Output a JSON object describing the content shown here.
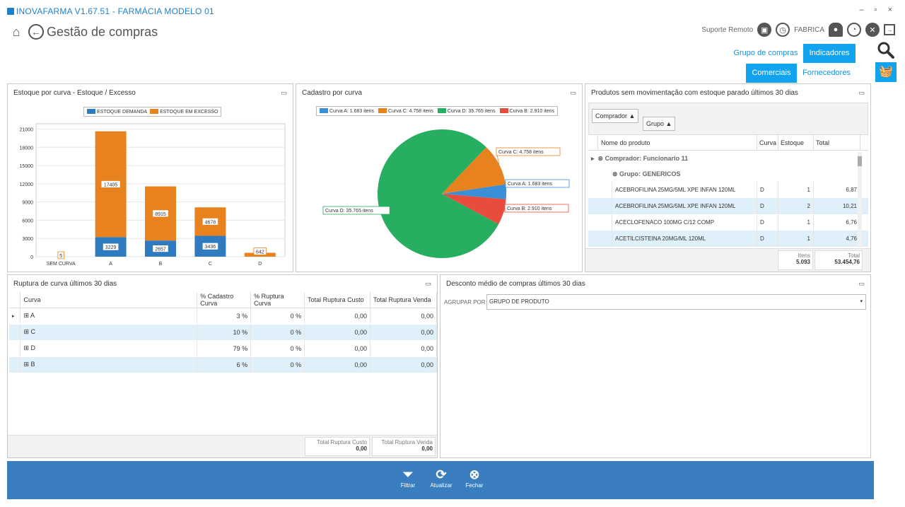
{
  "app": {
    "title": "INOVAFARMA  V1.67.51 - FARMÁCIA MODELO 01",
    "page_title": "Gestão de compras",
    "window_controls": "– ▫ ×"
  },
  "header": {
    "suporte_label": "Suporte Remoto",
    "user_label": "FABRICA"
  },
  "nav": {
    "grupo_compras": "Grupo de compras",
    "indicadores": "Indicadores",
    "comerciais": "Comerciais",
    "fornecedores": "Fornecedores"
  },
  "colors": {
    "accent": "#12a3ee",
    "demanda": "#2e7bbf",
    "excesso": "#e8821e",
    "curvaA": "#3b8fd6",
    "curvaB": "#e84c3d",
    "curvaC": "#e8821e",
    "curvaD": "#27ae60",
    "bottombar": "#3a7ebf"
  },
  "estoque_panel": {
    "title": "Estoque por curva - Estoque / Excesso",
    "legend": [
      "ESTOQUE DEMANDA",
      "ESTOQUE EM EXCESSO"
    ]
  },
  "cadastro_panel": {
    "title": "Cadastro por curva",
    "legend": [
      "Curva A: 1.683 itens",
      "Curva C: 4.758 itens",
      "Curva D: 35.765 itens",
      "Curva B: 2.910 itens"
    ],
    "labels": {
      "C": "Curva C: 4.758 itens",
      "A": "Curva A: 1.683 itens",
      "B": "Curva B: 2.910 itens",
      "D": "Curva D: 35.765 itens"
    }
  },
  "chart_data": [
    {
      "type": "bar",
      "stacked": true,
      "title": "Estoque por curva - Estoque / Excesso",
      "categories": [
        "SEM CURVA",
        "A",
        "B",
        "C",
        "D"
      ],
      "series": [
        {
          "name": "ESTOQUE DEMANDA",
          "values": [
            0,
            3229,
            2657,
            3436,
            0
          ]
        },
        {
          "name": "ESTOQUE EM EXCESSO",
          "values": [
            5,
            17405,
            8915,
            4678,
            642
          ]
        }
      ],
      "yticks": [
        "0",
        "3000",
        "6000",
        "9000",
        "12000",
        "15000",
        "18000",
        "21000"
      ],
      "ylim": [
        0,
        21000
      ],
      "grid": true,
      "legend": "top"
    },
    {
      "type": "pie",
      "title": "Cadastro por curva",
      "categories": [
        "Curva A",
        "Curva C",
        "Curva D",
        "Curva B"
      ],
      "values": [
        1683,
        4758,
        35765,
        2910
      ]
    }
  ],
  "produtos_panel": {
    "title": "Produtos sem movimentação com estoque parado últimos 30 dias",
    "group_comprador": "Comprador",
    "group_grupo": "Grupo",
    "columns": [
      "Nome do produto",
      "Curva",
      "Estoque",
      "Total"
    ],
    "group_row": "Comprador: Funcionario 11",
    "subgroup_row": "Grupo: GENERICOS",
    "rows": [
      {
        "nome": "ACEBROFILINA 25MG/5ML XPE INFAN 120ML",
        "curva": "D",
        "estoque": "1",
        "total": "6,87"
      },
      {
        "nome": "ACEBROFILINA 25MG/5ML XPE INFAN 120ML",
        "curva": "D",
        "estoque": "2",
        "total": "10,21"
      },
      {
        "nome": "ACECLOFENACO 100MG C/12 COMP",
        "curva": "D",
        "estoque": "1",
        "total": "6,76"
      },
      {
        "nome": "ACETILCISTEINA 20MG/ML 120ML",
        "curva": "D",
        "estoque": "1",
        "total": "4,76"
      }
    ],
    "footer": {
      "itens_label": "Itens",
      "itens_value": "5.093",
      "total_label": "Total",
      "total_value": "53.454,76"
    }
  },
  "ruptura_panel": {
    "title": "Ruptura de curva últimos 30 dias",
    "columns": [
      "Curva",
      "% Cadastro Curva",
      "% Ruptura Curva",
      "Total Ruptura Custo",
      "Total Ruptura Venda"
    ],
    "rows": [
      {
        "curva": "A",
        "cadastro": "3 %",
        "ruptura": "0 %",
        "custo": "0,00",
        "venda": "0,00"
      },
      {
        "curva": "C",
        "cadastro": "10 %",
        "ruptura": "0 %",
        "custo": "0,00",
        "venda": "0,00"
      },
      {
        "curva": "D",
        "cadastro": "79 %",
        "ruptura": "0 %",
        "custo": "0,00",
        "venda": "0,00"
      },
      {
        "curva": "B",
        "cadastro": "6 %",
        "ruptura": "0 %",
        "custo": "0,00",
        "venda": "0,00"
      }
    ],
    "footer": {
      "custo_label": "Total Ruptura Custo",
      "custo_value": "0,00",
      "venda_label": "Total Ruptura Venda",
      "venda_value": "0,00"
    }
  },
  "desconto_panel": {
    "title": "Desconto médio de compras últimos 30 dias",
    "agrupar_label": "AGRUPAR POR",
    "agrupar_value": "GRUPO DE PRODUTO"
  },
  "bottombar": {
    "filtrar": "Filtrar",
    "atualizar": "Atualizar",
    "fechar": "Fechar"
  }
}
